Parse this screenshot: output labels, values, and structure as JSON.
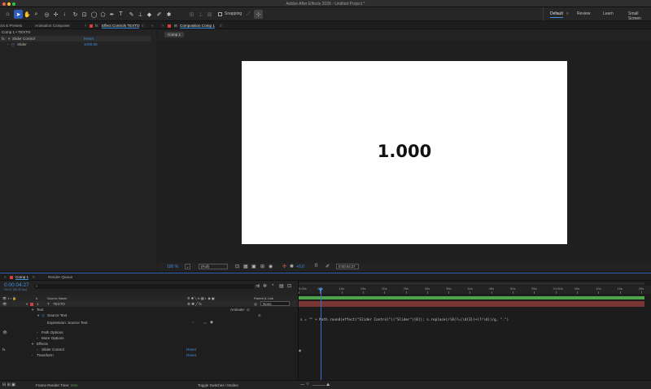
{
  "app": {
    "title": "Adobe After Effects 2026 - Untitled Project *"
  },
  "toolbar": {
    "snapping_label": "Snapping",
    "workspaces": [
      "Default",
      "Review",
      "Learn",
      "Small Screen"
    ],
    "active_workspace": "Default"
  },
  "left_panel": {
    "tabs": [
      "cts & Presets",
      "Animation Composer",
      "Effect Controls TEXTO"
    ],
    "breadcrumb": "Comp 1 • TEXTO",
    "effect": {
      "name": "Slider Control",
      "reset": "Reset"
    },
    "slider": {
      "name": "Slider",
      "value": "1000,00"
    }
  },
  "comp_panel": {
    "tab": "Composition Comp 1",
    "subtab": "Comp 1",
    "display_text": "1.000",
    "bottom": {
      "zoom": "100 %",
      "resolution": "(Full)",
      "exposure": "+0,0",
      "timecode": "0:00:04:27"
    }
  },
  "timeline": {
    "tabs": [
      "Comp 1",
      "Render Queue"
    ],
    "timecode": "0:00:04:27",
    "timecode_sub": "00147 (30.00 fps)",
    "col_source_name": "Source Name",
    "col_parent": "Parent & Link",
    "layer": {
      "num": "1",
      "name": "TEXTO",
      "parent": "None"
    },
    "animate_label": "Animate:",
    "rows": [
      {
        "label": "Text"
      },
      {
        "label": "Source Text"
      },
      {
        "label": "Expression: Source Text"
      },
      {
        "label": "Path Options"
      },
      {
        "label": "More Options"
      },
      {
        "label": "Effects"
      },
      {
        "label": "Slider Control",
        "reset": "Reset"
      },
      {
        "label": "Transform",
        "reset": "Reset"
      }
    ],
    "ruler": [
      "0:00s",
      "05s",
      "10s",
      "15s",
      "20s",
      "25s",
      "30s",
      "35s",
      "40s",
      "45s",
      "50s",
      "55s",
      "01:00s",
      "05s",
      "10s",
      "15s",
      "20s"
    ],
    "expression": "s = \"\" + Math.round(effect(\"Slider Control\")(\"Slider\")[0]); s.replace(/\\B(?=(\\d{3})+(?!\\d))/g, \".\")",
    "footer": {
      "render_time_label": "Frame Render Time:",
      "render_time_value": "0ms",
      "toggle": "Toggle Switches / Modes"
    }
  },
  "colors": {
    "accent": "#3e8fe0",
    "bg": "#1b1b1b",
    "panel": "#232323",
    "green_bar": "#4ea34b",
    "red_bar": "#7a3535"
  }
}
